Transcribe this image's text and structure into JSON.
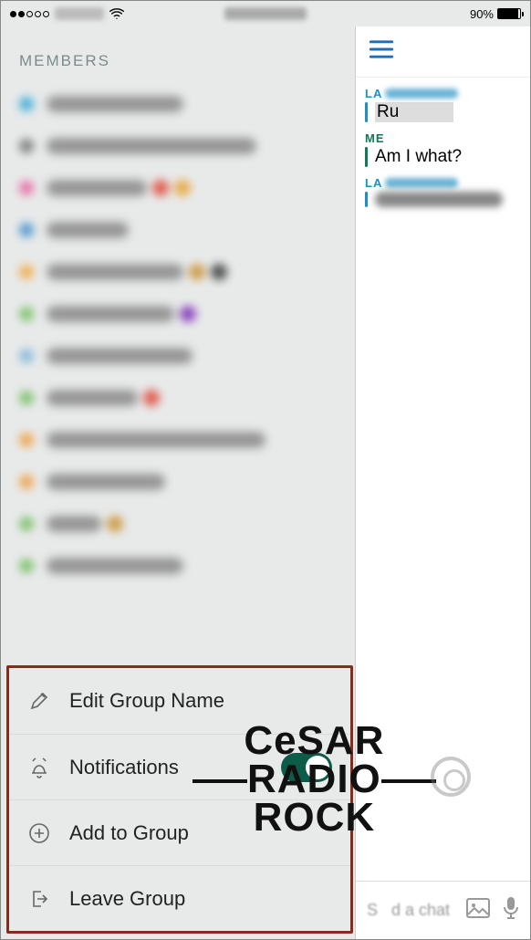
{
  "status": {
    "battery_pct": "90%"
  },
  "left": {
    "section_title": "MEMBERS",
    "actions": {
      "edit": "Edit Group Name",
      "notifications": "Notifications",
      "add": "Add to Group",
      "leave": "Leave Group"
    }
  },
  "chat": {
    "sender1_prefix": "LA",
    "msg1": "Ru",
    "sender2": "ME",
    "msg2": "Am I what?",
    "sender3_prefix": "LA",
    "input_placeholder": "Send a chat"
  },
  "watermark": {
    "l1": "CeSAR",
    "l2": "RADIO",
    "l3": "ROCK"
  },
  "member_dots": [
    "#2aa4d4",
    "#6b6b6b",
    "#e85b9a",
    "#3a89c9",
    "#f3a53a",
    "#6fbb5a",
    "#7ab4d6",
    "#6fbb5a",
    "#f09a3a",
    "#f09a3a",
    "#6fbb5a",
    "#6fbb5a"
  ]
}
